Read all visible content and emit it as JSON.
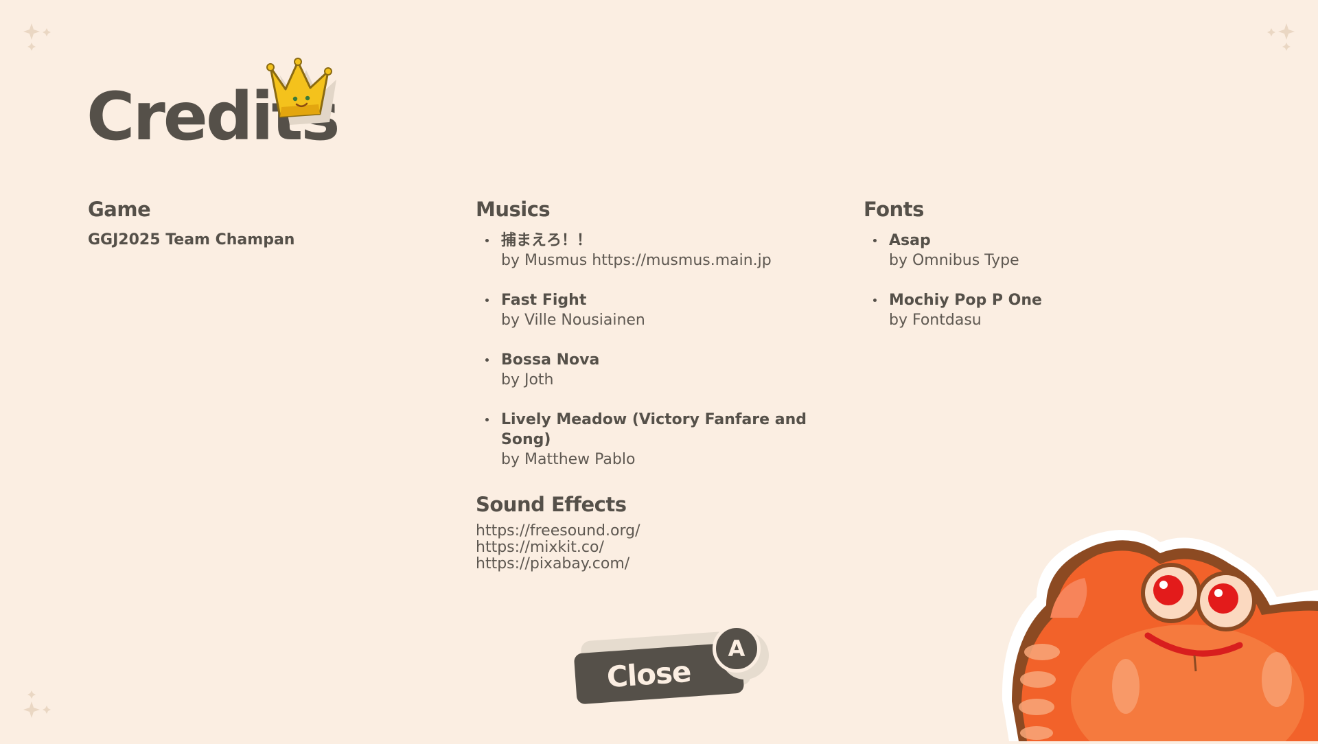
{
  "screen": {
    "title": "Credits",
    "accent_color": "#555049",
    "background_color": "#fbeee2"
  },
  "game": {
    "heading": "Game",
    "credit": "GGJ2025 Team Champan"
  },
  "musics": {
    "heading": "Musics",
    "items": [
      {
        "title": "捕まえろ！！",
        "by": "by Musmus https://musmus.main.jp"
      },
      {
        "title": "Fast Fight",
        "by": "by Ville Nousiainen"
      },
      {
        "title": "Bossa Nova",
        "by": "by Joth"
      },
      {
        "title": "Lively Meadow (Victory Fanfare and Song)",
        "by": "by Matthew Pablo"
      }
    ]
  },
  "fonts": {
    "heading": "Fonts",
    "items": [
      {
        "title": "Asap",
        "by": "by Omnibus Type"
      },
      {
        "title": "Mochiy Pop P One",
        "by": "by Fontdasu"
      }
    ]
  },
  "sound_effects": {
    "heading": "Sound Effects",
    "links": [
      "https://freesound.org/",
      "https://mixkit.co/",
      "https://pixabay.com/"
    ]
  },
  "close_button": {
    "label": "Close",
    "key_hint": "A"
  },
  "icons": {
    "title_decoration": "crown-icon",
    "corner_decoration": "sparkle-icon",
    "mascot": "crab-mascot"
  }
}
